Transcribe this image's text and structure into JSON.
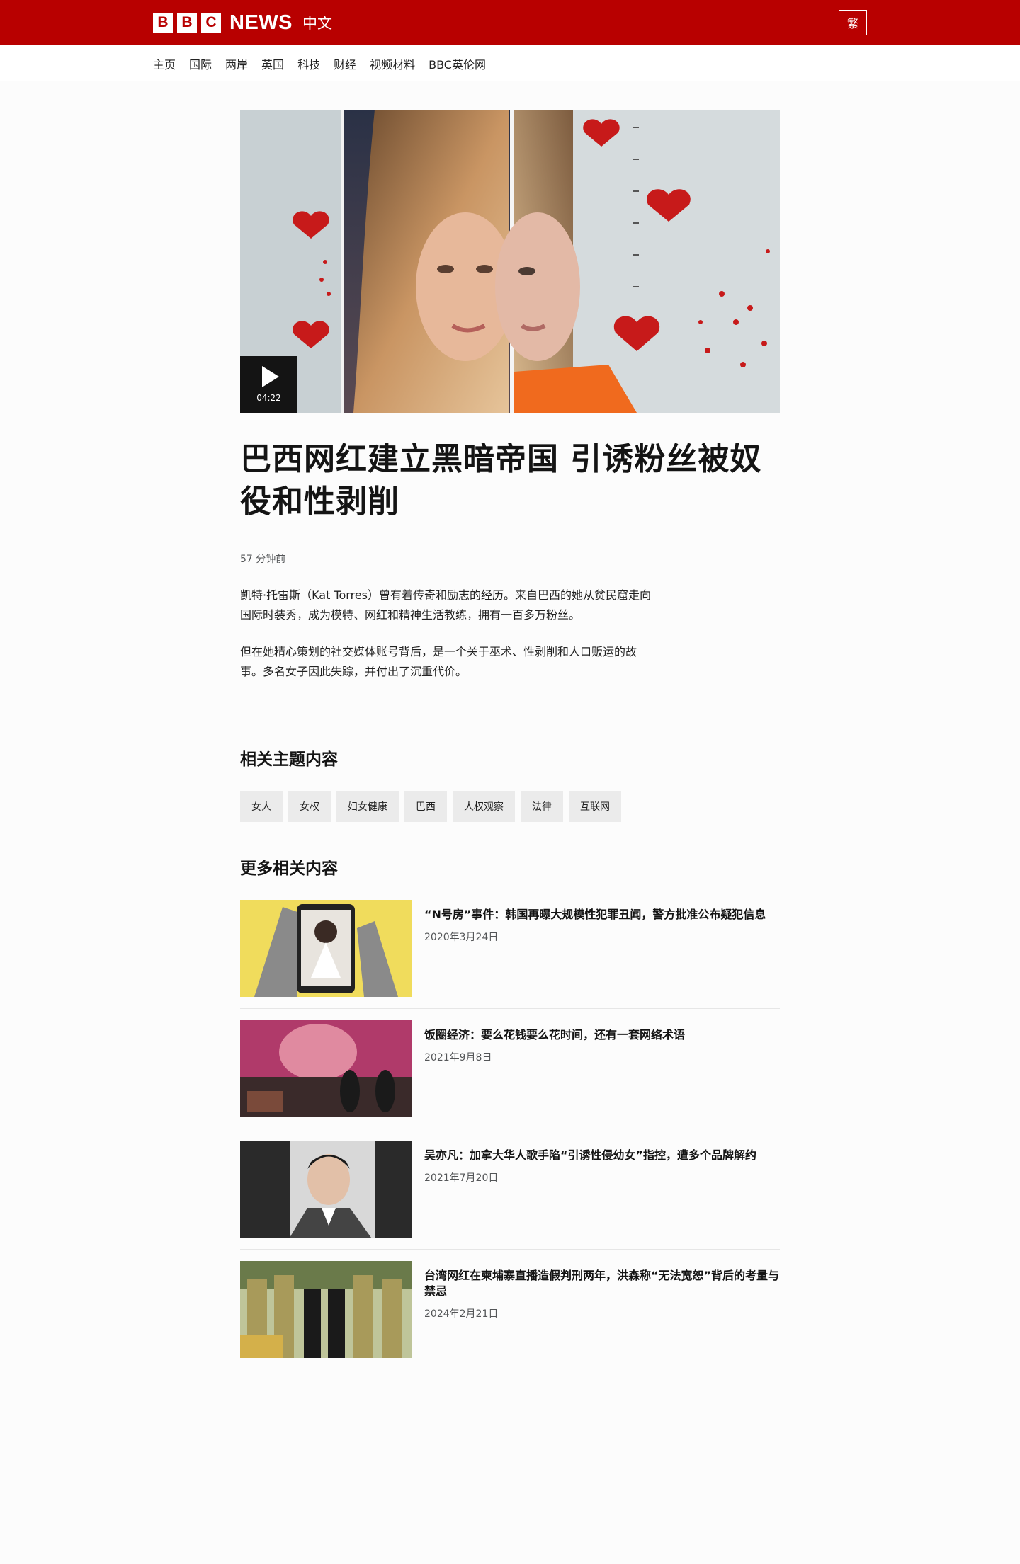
{
  "header": {
    "logo_letters": [
      "B",
      "B",
      "C"
    ],
    "logo_news": "NEWS",
    "logo_lang": "中文",
    "lang_switch": "繁"
  },
  "nav": {
    "items": [
      "主页",
      "国际",
      "两岸",
      "英国",
      "科技",
      "财经",
      "视频材料",
      "BBC英伦网"
    ]
  },
  "video": {
    "duration": "04:22"
  },
  "article": {
    "headline": "巴西网红建立黑暗帝国 引诱粉丝被奴役和性剥削",
    "timestamp": "57 分钟前",
    "paragraphs": [
      "凯特·托雷斯（Kat Torres）曾有着传奇和励志的经历。来自巴西的她从贫民窟走向国际时装秀，成为模特、网红和精神生活教练，拥有一百多万粉丝。",
      "但在她精心策划的社交媒体账号背后，是一个关于巫术、性剥削和人口贩运的故事。多名女子因此失踪，并付出了沉重代价。"
    ]
  },
  "topics": {
    "title": "相关主题内容",
    "tags": [
      "女人",
      "女权",
      "妇女健康",
      "巴西",
      "人权观察",
      "法律",
      "互联网"
    ]
  },
  "more": {
    "title": "更多相关内容",
    "items": [
      {
        "title": "“N号房”事件：韩国再曝大规模性犯罪丑闻，警方批准公布疑犯信息",
        "date": "2020年3月24日"
      },
      {
        "title": "饭圈经济：要么花钱要么花时间，还有一套网络术语",
        "date": "2021年9月8日"
      },
      {
        "title": "吴亦凡：加拿大华人歌手陷“引诱性侵幼女”指控，遭多个品牌解约",
        "date": "2021年7月20日"
      },
      {
        "title": "台湾网红在柬埔寨直播造假判刑两年，洪森称“无法宽恕”背后的考量与禁忌",
        "date": "2024年2月21日"
      }
    ]
  },
  "colors": {
    "brand_red": "#b80000",
    "tag_bg": "#ebebeb"
  }
}
